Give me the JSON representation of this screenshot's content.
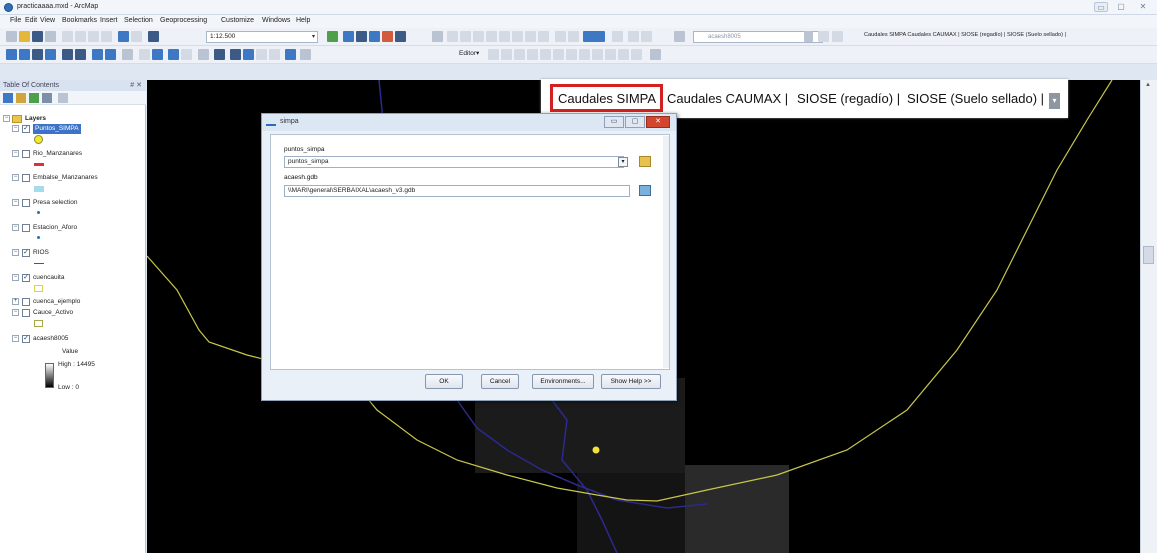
{
  "window": {
    "title": "practicaaaa.mxd - ArcMap",
    "controls": {
      "minimize": "▭",
      "maximize": "▢",
      "close": "✕"
    }
  },
  "menubar": {
    "items": [
      "File",
      "Edit",
      "View",
      "Bookmarks",
      "Insert",
      "Selection",
      "Geoprocessing",
      "Customize",
      "Windows",
      "Help"
    ]
  },
  "toolbar": {
    "scale": "1:12.500",
    "editor_label": "Editor▾",
    "layer_combo_value": "acaesh8005",
    "bookmarks_text": "Caudales SIMPA  Caudales CAUMAX |  SIOSE (regadío) |  SIOSE (Suelo sellado) |"
  },
  "toc": {
    "title": "Table Of Contents",
    "pin": "# ✕",
    "layers_root": "Layers",
    "layers": [
      {
        "name": "Puntos_SIMPA",
        "checked": true,
        "selected": true
      },
      {
        "name": "Rio_Manzanares",
        "checked": false
      },
      {
        "name": "Embalse_Manzanares",
        "checked": false
      },
      {
        "name": "Presa selection",
        "checked": false
      },
      {
        "name": "Estacion_Aforo",
        "checked": false
      },
      {
        "name": "RIOS",
        "checked": true
      },
      {
        "name": "cuencauita",
        "checked": true
      },
      {
        "name": "cuenca_ejemplo",
        "checked": false
      },
      {
        "name": "Cauce_Activo",
        "checked": false
      },
      {
        "name": "acaesh8005",
        "checked": true
      }
    ],
    "legend": {
      "value_label": "Value",
      "high": "High : 14495",
      "low": "Low : 0"
    }
  },
  "callout": {
    "items": [
      "Caudales SIMPA",
      "Caudales CAUMAX |",
      "SIOSE (regadío) |",
      "SIOSE (Suelo sellado) |"
    ],
    "dropdown": "▾",
    "highlight_color": "#d42020"
  },
  "dialog": {
    "title": "simpa",
    "field1": {
      "label": "puntos_simpa",
      "value": "puntos_simpa"
    },
    "field2": {
      "label": "acaesh.gdb",
      "value": "\\\\MARI\\general\\SERBAIXAL\\acaesh_v3.gdb"
    },
    "buttons": {
      "ok": "OK",
      "cancel": "Cancel",
      "environments": "Environments...",
      "help": "Show Help >>"
    }
  },
  "colors": {
    "map_background": "#000000",
    "boundary_line": "#c9c64a",
    "river_line": "#2b2a8c",
    "point": "#f2e23a"
  }
}
